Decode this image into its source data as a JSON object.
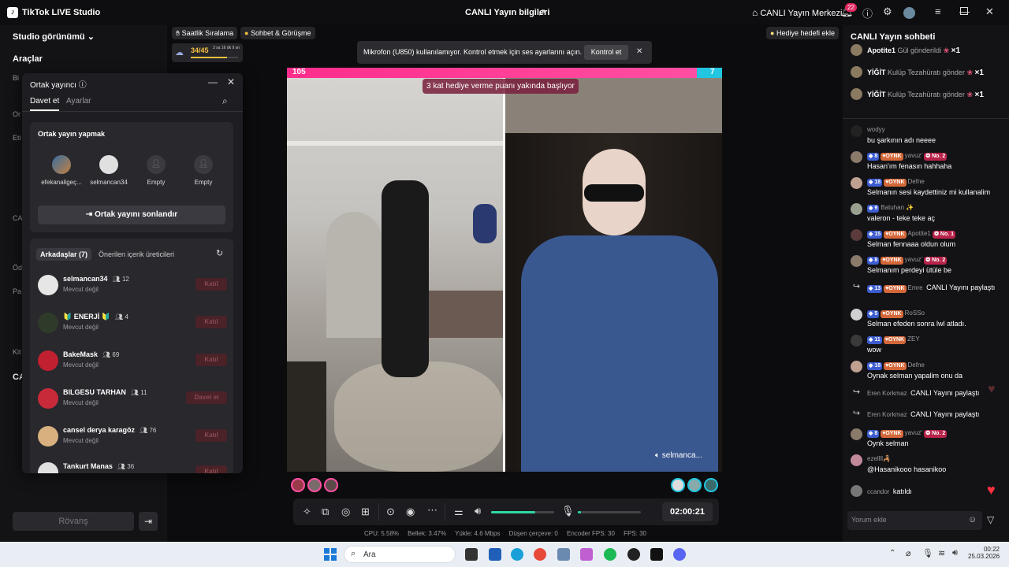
{
  "app": {
    "name": "TikTok LIVE Studio",
    "center_title": "CANLI Yayın bilgileri",
    "live_center": "CANLI Yayın Merkezi",
    "notification_count": "22"
  },
  "left_panel": {
    "studio_view": "Studio görünümü",
    "tools": "Araçlar",
    "partial_labels": [
      "Bi",
      "Or",
      "Eti",
      "CA",
      "Öd",
      "Pa",
      "Kit",
      "CA"
    ],
    "rematch": "Rövanş"
  },
  "cohost": {
    "title": "Ortak yayıncı",
    "tabs": [
      "Davet et",
      "Ayarlar"
    ],
    "section_title": "Ortak yayın yapmak",
    "guests": [
      {
        "name": "efekanaligeç...",
        "color": "#4a7fb0"
      },
      {
        "name": "selmancan34",
        "color": "#d9d9d9"
      },
      {
        "name": "Empty",
        "color": "#33333a"
      },
      {
        "name": "Empty",
        "color": "#33333a"
      }
    ],
    "end_button": "Ortak yayını sonlandır",
    "friends_tab": "Arkadaşlar (7)",
    "suggested_tab": "Önerilen içerik üreticileri",
    "friends": [
      {
        "name": "selmancan34",
        "count": "12",
        "status": "Mevcut değil",
        "button": "Katıl",
        "color": "#e6e6e6"
      },
      {
        "name": "🔰 ENERJİ 🔰",
        "count": "4",
        "status": "Mevcut değil",
        "button": "Katıl",
        "color": "#2e3a2a"
      },
      {
        "name": "BakeMask",
        "count": "69",
        "status": "Mevcut değil",
        "button": "Katıl",
        "color": "#c02030"
      },
      {
        "name": "BILGESU TARHAN",
        "count": "11",
        "status": "Mevcut değil",
        "button": "Davet et",
        "color": "#c82a3a"
      },
      {
        "name": "cansel derya karagöz",
        "count": "76",
        "status": "Mevcut değil",
        "button": "Katıl",
        "color": "#d8b080"
      },
      {
        "name": "Tankurt Manas",
        "count": "36",
        "status": "",
        "button": "Katıl",
        "color": "#e0e0e0"
      }
    ]
  },
  "chips": {
    "hourly": "Saatlik Sıralama",
    "chat_meet": "Sohbet & Görüşme",
    "goal": "Hediye hedefi ekle",
    "level_progress": "34/45",
    "level_time": "3 sa 16 dk 9 sn"
  },
  "notice": {
    "text": "Mikrofon (U850) kullanılamıyor. Kontrol etmek için ses ayarlarını açın.",
    "button": "Kontrol et"
  },
  "battle": {
    "left_score": "105",
    "right_score": "7",
    "banner": "3 kat hediye verme puanı yakında başlıyor",
    "cohost_label": "selmanca..."
  },
  "controls": {
    "timer": "02:00:21",
    "volume": 0.7,
    "mic": 0.05
  },
  "stats": [
    {
      "label": "CPU:",
      "value": "5.58%"
    },
    {
      "label": "Bellek:",
      "value": "3.47%"
    },
    {
      "label": "Yükle:",
      "value": "4.6 Mbps"
    },
    {
      "label": "Düşen çerçeve:",
      "value": "0"
    },
    {
      "label": "Encoder FPS:",
      "value": "30"
    },
    {
      "label": "FPS:",
      "value": "30"
    }
  ],
  "chat": {
    "title": "CANLI Yayın sohbeti",
    "gifts": [
      {
        "user": "Apotite1",
        "text": "Gül gönderildi",
        "mult": "×1"
      },
      {
        "user": "YİĞİT",
        "text": "Kulüp Tezahüratı gönder",
        "mult": "×1"
      },
      {
        "user": "YİĞİT",
        "text": "Kulüp Tezahüratı gönder",
        "mult": "×1"
      }
    ],
    "messages": [
      {
        "user": "wodyy",
        "lvl": "",
        "fan": "",
        "rank": "",
        "msg": "bu şarkının adı neeee",
        "color": "#222"
      },
      {
        "user": "yavuz'",
        "lvl": "8",
        "fan": "OYNK",
        "rank": "No. 2",
        "msg": "Hasan'ım fenasın hahhaha",
        "color": "#8a7a6a"
      },
      {
        "user": "Defne",
        "lvl": "18",
        "fan": "OYNK",
        "rank": "",
        "msg": "Selmanın sesi kaydettiniz mi kullanalim",
        "color": "#c0a090"
      },
      {
        "user": "Batuhan ✨",
        "lvl": "9",
        "fan": "",
        "rank": "",
        "msg": "valeron - teke teke aç",
        "color": "#9aa090"
      },
      {
        "user": "Apotite1",
        "lvl": "15",
        "fan": "OYNK",
        "rank": "No. 1",
        "msg": "Selman fennaaa oldun olum",
        "color": "#5a3a3a"
      },
      {
        "user": "yavuz'",
        "lvl": "8",
        "fan": "OYNK",
        "rank": "No. 2",
        "msg": "Selmanım perdeyi ütüle be",
        "color": "#8a7a6a"
      },
      {
        "user": "Emre",
        "lvl": "13",
        "fan": "OYNK",
        "rank": "",
        "msg": "CANLI Yayını paylaştı",
        "color": "share"
      },
      {
        "user": "RoSSo",
        "lvl": "5",
        "fan": "OYNK",
        "rank": "",
        "msg": "Selman efeden sonra lwl atladı.",
        "color": "#d0d0d0"
      },
      {
        "user": "ZEY",
        "lvl": "11",
        "fan": "OYNK",
        "rank": "",
        "msg": "wow",
        "color": "#3a3a3a"
      },
      {
        "user": "Defne",
        "lvl": "18",
        "fan": "OYNK",
        "rank": "",
        "msg": "Oynak selman yapalim onu da",
        "color": "#c0a090"
      },
      {
        "user": "Eren Korkmaz",
        "lvl": "",
        "fan": "",
        "rank": "",
        "msg": "CANLI Yayını paylaştı",
        "color": "share"
      },
      {
        "user": "Eren Korkmaz",
        "lvl": "",
        "fan": "",
        "rank": "",
        "msg": "CANLI Yayını paylaştı",
        "color": "share"
      },
      {
        "user": "yavuz'",
        "lvl": "8",
        "fan": "OYNK",
        "rank": "No. 2",
        "msg": "Oynk selman",
        "color": "#8a7a6a"
      },
      {
        "user": "ezellll🦂",
        "lvl": "",
        "fan": "",
        "rank": "",
        "msg": "@Hasanikooo hasanikoo",
        "color": "#c08a9a"
      },
      {
        "user": "ccandor",
        "lvl": "",
        "fan": "",
        "rank": "",
        "msg": "katıldı",
        "color": "#777"
      }
    ],
    "input_placeholder": "Yorum ekle"
  },
  "taskbar": {
    "search": "Ara",
    "time": "00:22",
    "date": "25.03.2026"
  }
}
